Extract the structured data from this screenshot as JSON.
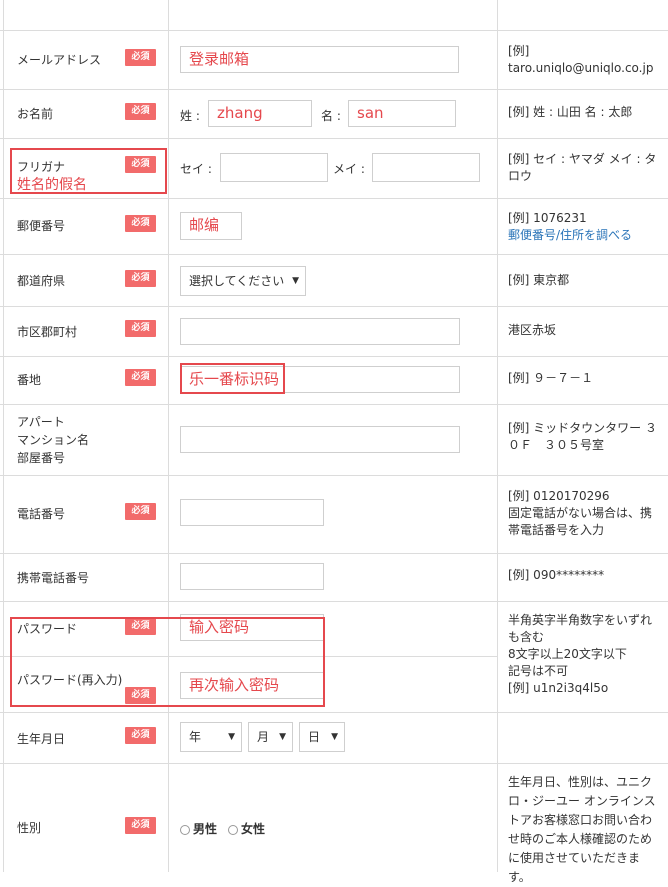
{
  "required_badge": "必須",
  "rows": {
    "email": {
      "label": "メールアドレス",
      "input_value": "登录邮箱",
      "example": "[例]\ntaro.uniqlo@uniqlo.co.jp"
    },
    "name": {
      "label": "お名前",
      "sei_label": "姓 :",
      "sei_value": "zhang",
      "mei_label": "名 :",
      "mei_value": "san",
      "example": "[例] 姓 : 山田 名 : 太郎"
    },
    "furigana": {
      "label": "フリガナ",
      "annotation": "姓名的假名",
      "sei_label": "セイ :",
      "mei_label": "メイ :",
      "example": "[例] セイ : ヤマダ メイ : タロウ"
    },
    "postal": {
      "label": "郵便番号",
      "input_value": "邮编",
      "example": "[例] 1076231",
      "example_link": "郵便番号/住所を調べる"
    },
    "prefecture": {
      "label": "都道府県",
      "selected": "選択してください",
      "example": "[例] 東京都"
    },
    "city": {
      "label": "市区郡町村",
      "example": "港区赤坂"
    },
    "address": {
      "label": "番地",
      "input_value": "乐一番标识码",
      "example": "[例] ９－７－１"
    },
    "apartment": {
      "label_line1": "アパート",
      "label_line2": "マンション名",
      "label_line3": "部屋番号",
      "example": "[例] ミッドタウンタワー ３０Ｆ　３０５号室"
    },
    "phone": {
      "label": "電話番号",
      "example": "[例] 0120170296\n固定電話がない場合は、携帯電話番号を入力"
    },
    "mobile": {
      "label": "携帯電話番号",
      "example": "[例] 090********"
    },
    "password": {
      "label": "パスワード",
      "input_value": "输入密码",
      "example": "半角英字半角数字をいずれも含む\n8文字以上20文字以下\n記号は不可\n[例] u1n2i3q4l5o"
    },
    "password_confirm": {
      "label": "パスワード(再入力)",
      "input_value": "再次输入密码"
    },
    "birthday": {
      "label": "生年月日",
      "year": "年",
      "month": "月",
      "day": "日"
    },
    "gender": {
      "label": "性別",
      "male": "男性",
      "female": "女性",
      "example": "生年月日、性別は、ユニクロ・ジーユー オンラインストアお客様窓口お問い合わせ時のご本人様確認のために使用させていただきます。"
    }
  },
  "colors": {
    "required": "#f26b6b",
    "annotation": "#e5484d",
    "link": "#2a74b8"
  }
}
